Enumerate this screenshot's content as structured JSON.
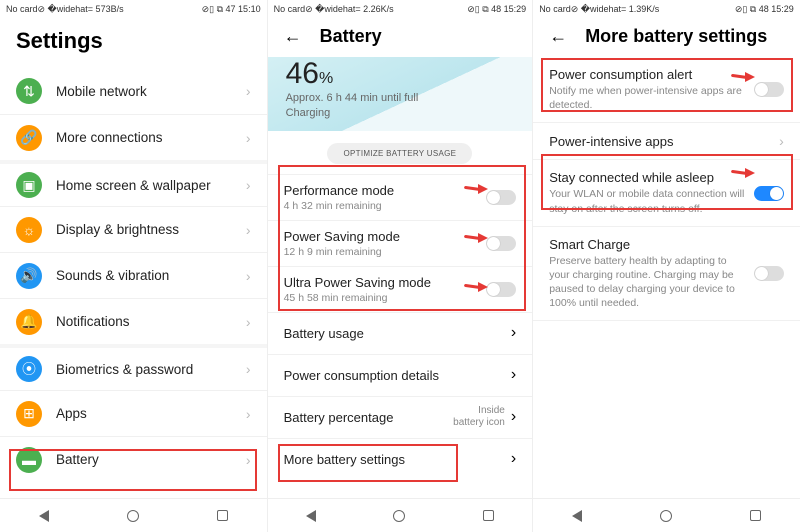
{
  "screen1": {
    "status": {
      "left": "No card⊘  �widehat= 573B/s",
      "right": "⊘▯ ⧉  47  15:10"
    },
    "title": "Settings",
    "items": [
      {
        "label": "Mobile network",
        "iconClass": "ico-mobile",
        "glyph": "⇅",
        "section": false
      },
      {
        "label": "More connections",
        "iconClass": "ico-conn",
        "glyph": "🔗",
        "section": false
      },
      {
        "label": "Home screen & wallpaper",
        "iconClass": "ico-home",
        "glyph": "▣",
        "section": true
      },
      {
        "label": "Display & brightness",
        "iconClass": "ico-disp",
        "glyph": "☼",
        "section": false
      },
      {
        "label": "Sounds & vibration",
        "iconClass": "ico-sound",
        "glyph": "🔊",
        "section": false
      },
      {
        "label": "Notifications",
        "iconClass": "ico-notif",
        "glyph": "🔔",
        "section": false
      },
      {
        "label": "Biometrics & password",
        "iconClass": "ico-bio",
        "glyph": "⦿",
        "section": true
      },
      {
        "label": "Apps",
        "iconClass": "ico-apps",
        "glyph": "⊞",
        "section": false
      },
      {
        "label": "Battery",
        "iconClass": "ico-batt",
        "glyph": "▬",
        "section": false
      }
    ]
  },
  "screen2": {
    "status": {
      "left": "No card⊘  �widehat= 2.26K/s",
      "right": "⊘▯ ⧉  48  15:29"
    },
    "title": "Battery",
    "percent": "46",
    "percent_unit": "%",
    "sub1": "Approx. 6 h 44 min until full",
    "sub2": "Charging",
    "optimize": "OPTIMIZE BATTERY USAGE",
    "modes": [
      {
        "title": "Performance mode",
        "sub": "4 h 32 min remaining",
        "on": false
      },
      {
        "title": "Power Saving mode",
        "sub": "12 h 9 min remaining",
        "on": false
      },
      {
        "title": "Ultra Power Saving mode",
        "sub": "45 h 58 min remaining",
        "on": false
      }
    ],
    "rows": [
      {
        "title": "Battery usage",
        "rval": ""
      },
      {
        "title": "Power consumption details",
        "rval": ""
      },
      {
        "title": "Battery percentage",
        "rval": "Inside\nbattery icon"
      },
      {
        "title": "More battery settings",
        "rval": ""
      }
    ]
  },
  "screen3": {
    "status": {
      "left": "No card⊘  �widehat= 1.39K/s",
      "right": "⊘▯ ⧉  48  15:29"
    },
    "title": "More battery settings",
    "rows": [
      {
        "title": "Power consumption alert",
        "sub": "Notify me when power-intensive apps are detected.",
        "type": "toggle",
        "on": false
      },
      {
        "title": "Power-intensive apps",
        "sub": "",
        "type": "chev"
      },
      {
        "title": "Stay connected while asleep",
        "sub": "Your WLAN or mobile data connection will stay on after the screen turns off.",
        "type": "toggle",
        "on": true
      },
      {
        "title": "Smart Charge",
        "sub": "Preserve battery health by adapting to your charging routine. Charging may be paused to delay charging your device to 100% until needed.",
        "type": "toggle",
        "on": false
      }
    ]
  }
}
